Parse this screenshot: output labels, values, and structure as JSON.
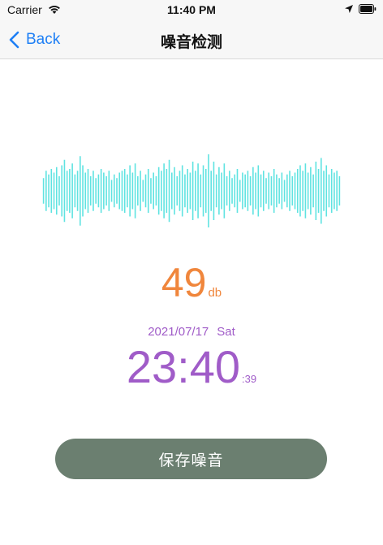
{
  "status_bar": {
    "carrier": "Carrier",
    "time": "11:40 PM",
    "icons": [
      "wifi-icon",
      "location-icon",
      "battery-icon"
    ]
  },
  "nav": {
    "back_label": "Back",
    "title": "噪音检测"
  },
  "waveform": {
    "color": "#5fe3e1",
    "bar_levels": [
      0.35,
      0.55,
      0.45,
      0.6,
      0.5,
      0.65,
      0.4,
      0.7,
      0.85,
      0.55,
      0.6,
      0.75,
      0.45,
      0.55,
      0.95,
      0.7,
      0.5,
      0.6,
      0.4,
      0.55,
      0.35,
      0.45,
      0.6,
      0.5,
      0.4,
      0.55,
      0.3,
      0.45,
      0.35,
      0.5,
      0.55,
      0.6,
      0.45,
      0.7,
      0.5,
      0.75,
      0.4,
      0.55,
      0.3,
      0.45,
      0.6,
      0.35,
      0.5,
      0.4,
      0.65,
      0.55,
      0.75,
      0.6,
      0.85,
      0.5,
      0.65,
      0.4,
      0.55,
      0.7,
      0.45,
      0.6,
      0.5,
      0.8,
      0.55,
      0.75,
      0.45,
      0.7,
      0.6,
      1.0,
      0.55,
      0.8,
      0.45,
      0.65,
      0.5,
      0.75,
      0.4,
      0.55,
      0.35,
      0.45,
      0.6,
      0.3,
      0.5,
      0.45,
      0.55,
      0.4,
      0.65,
      0.5,
      0.7,
      0.45,
      0.55,
      0.35,
      0.5,
      0.4,
      0.6,
      0.45,
      0.35,
      0.5,
      0.3,
      0.45,
      0.55,
      0.4,
      0.5,
      0.6,
      0.7,
      0.55,
      0.75,
      0.5,
      0.65,
      0.45,
      0.8,
      0.6,
      0.9,
      0.55,
      0.7,
      0.45,
      0.6,
      0.5,
      0.55,
      0.4
    ]
  },
  "noise": {
    "value": "49",
    "unit": "db",
    "color": "#f0863c"
  },
  "datetime": {
    "date": "2021/07/17",
    "weekday": "Sat",
    "time": "23:40",
    "seconds": ":39",
    "color": "#a05cc8"
  },
  "actions": {
    "save_label": "保存噪音",
    "button_color": "#6b7f70"
  }
}
